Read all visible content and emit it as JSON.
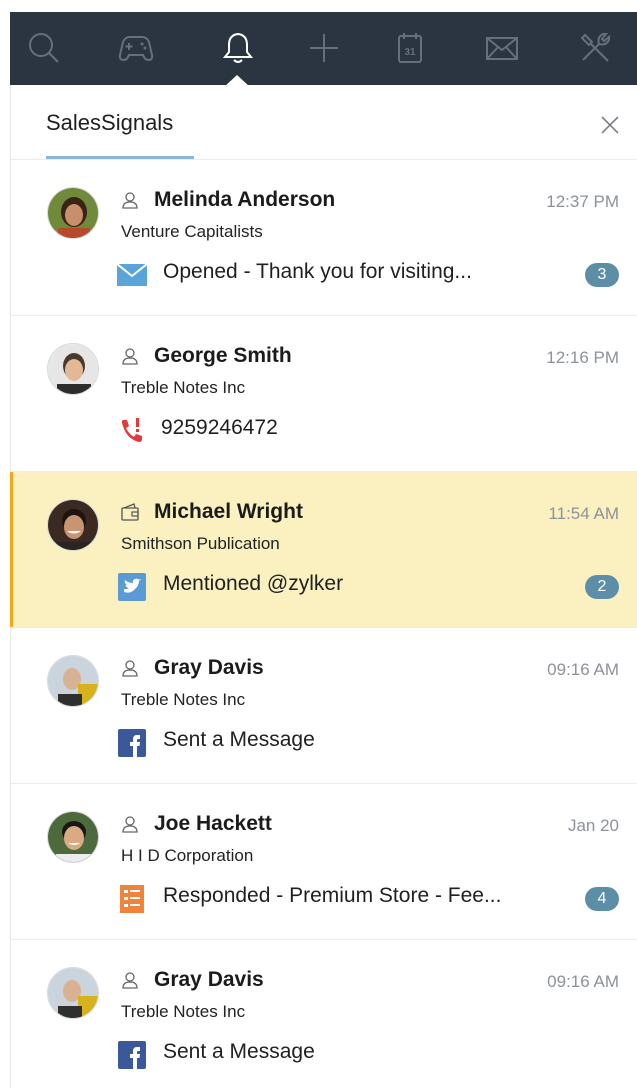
{
  "toolbar": {
    "icons": [
      "search-icon",
      "gamepad-icon",
      "bell-icon",
      "plus-icon",
      "calendar-icon",
      "mail-icon",
      "tools-icon"
    ],
    "calendar_day": "31",
    "active": "bell-icon",
    "bg_color": "#2b3441"
  },
  "header": {
    "title": "SalesSignals",
    "underline_color": "#8bb6d6"
  },
  "signals": [
    {
      "name": "Melinda Anderson",
      "contact_type": "user-icon",
      "company": "Venture Capitalists",
      "time": "12:37 PM",
      "activity_icon": "email-icon",
      "activity": "Opened - Thank you for visiting...",
      "count": "3",
      "highlighted": false
    },
    {
      "name": "George Smith",
      "contact_type": "user-icon",
      "company": "Treble Notes Inc",
      "time": "12:16 PM",
      "activity_icon": "missed-call-icon",
      "activity": "9259246472",
      "count": "",
      "highlighted": false
    },
    {
      "name": "Michael Wright",
      "contact_type": "wallet-icon",
      "company": "Smithson Publication",
      "time": "11:54 AM",
      "activity_icon": "twitter-icon",
      "activity": "Mentioned @zylker",
      "count": "2",
      "highlighted": true
    },
    {
      "name": "Gray Davis",
      "contact_type": "user-icon",
      "company": "Treble Notes Inc",
      "time": "09:16 AM",
      "activity_icon": "facebook-icon",
      "activity": "Sent a Message",
      "count": "",
      "highlighted": false
    },
    {
      "name": "Joe Hackett",
      "contact_type": "user-icon",
      "company": "H I D Corporation",
      "time": "Jan 20",
      "activity_icon": "survey-icon",
      "activity": "Responded - Premium Store - Fee...",
      "count": "4",
      "highlighted": false
    },
    {
      "name": "Gray Davis",
      "contact_type": "user-icon",
      "company": "Treble Notes Inc",
      "time": "09:16 AM",
      "activity_icon": "facebook-icon",
      "activity": "Sent a Message",
      "count": "",
      "highlighted": false
    }
  ],
  "colors": {
    "highlight_bg": "#fbf0c0",
    "highlight_bar": "#f3a71b",
    "badge": "#5d8ea7",
    "email": "#5aa4dc",
    "missed_call": "#e4383a",
    "twitter": "#5b9bd5",
    "facebook": "#3b5998",
    "survey": "#f0823c"
  }
}
